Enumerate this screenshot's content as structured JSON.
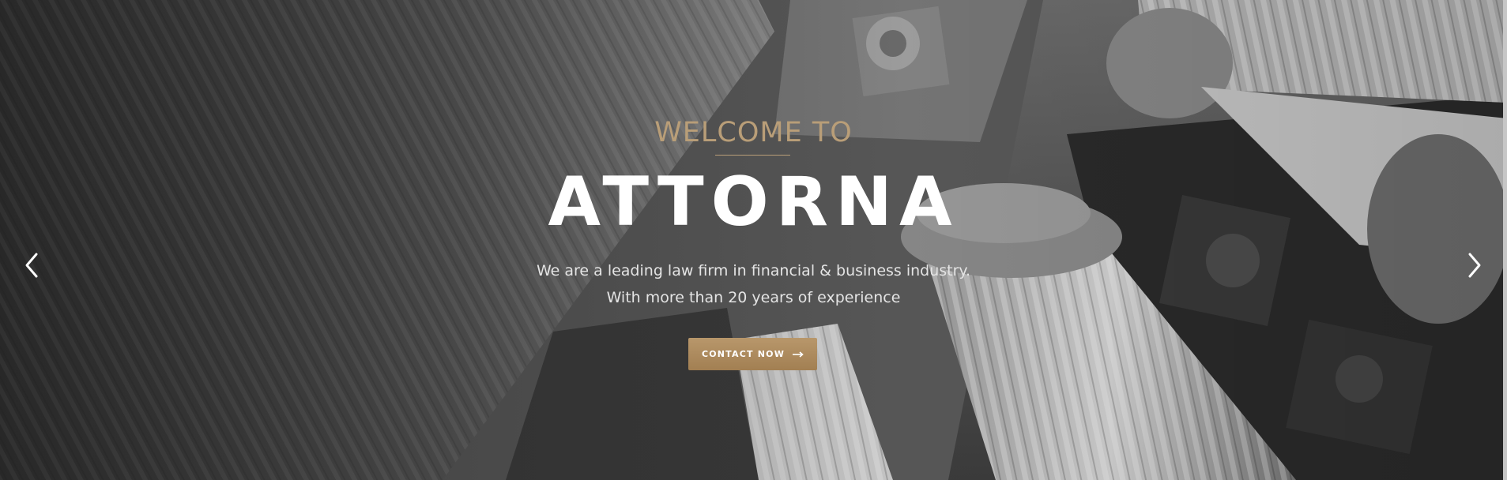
{
  "hero": {
    "welcome": "WELCOME TO",
    "title": "ATTORNA",
    "subtitle_line1": "We are a leading law firm in financial & business industry.",
    "subtitle_line2": "With more than 20 years of experience",
    "cta_label": "CONTACT NOW",
    "cta_icon": "long-arrow-right-icon",
    "prev_icon": "chevron-left-icon",
    "next_icon": "chevron-right-icon",
    "background": "courthouse-columns-photo"
  },
  "colors": {
    "accent": "#b99e78",
    "button": "#a88659",
    "title": "#ffffff"
  }
}
